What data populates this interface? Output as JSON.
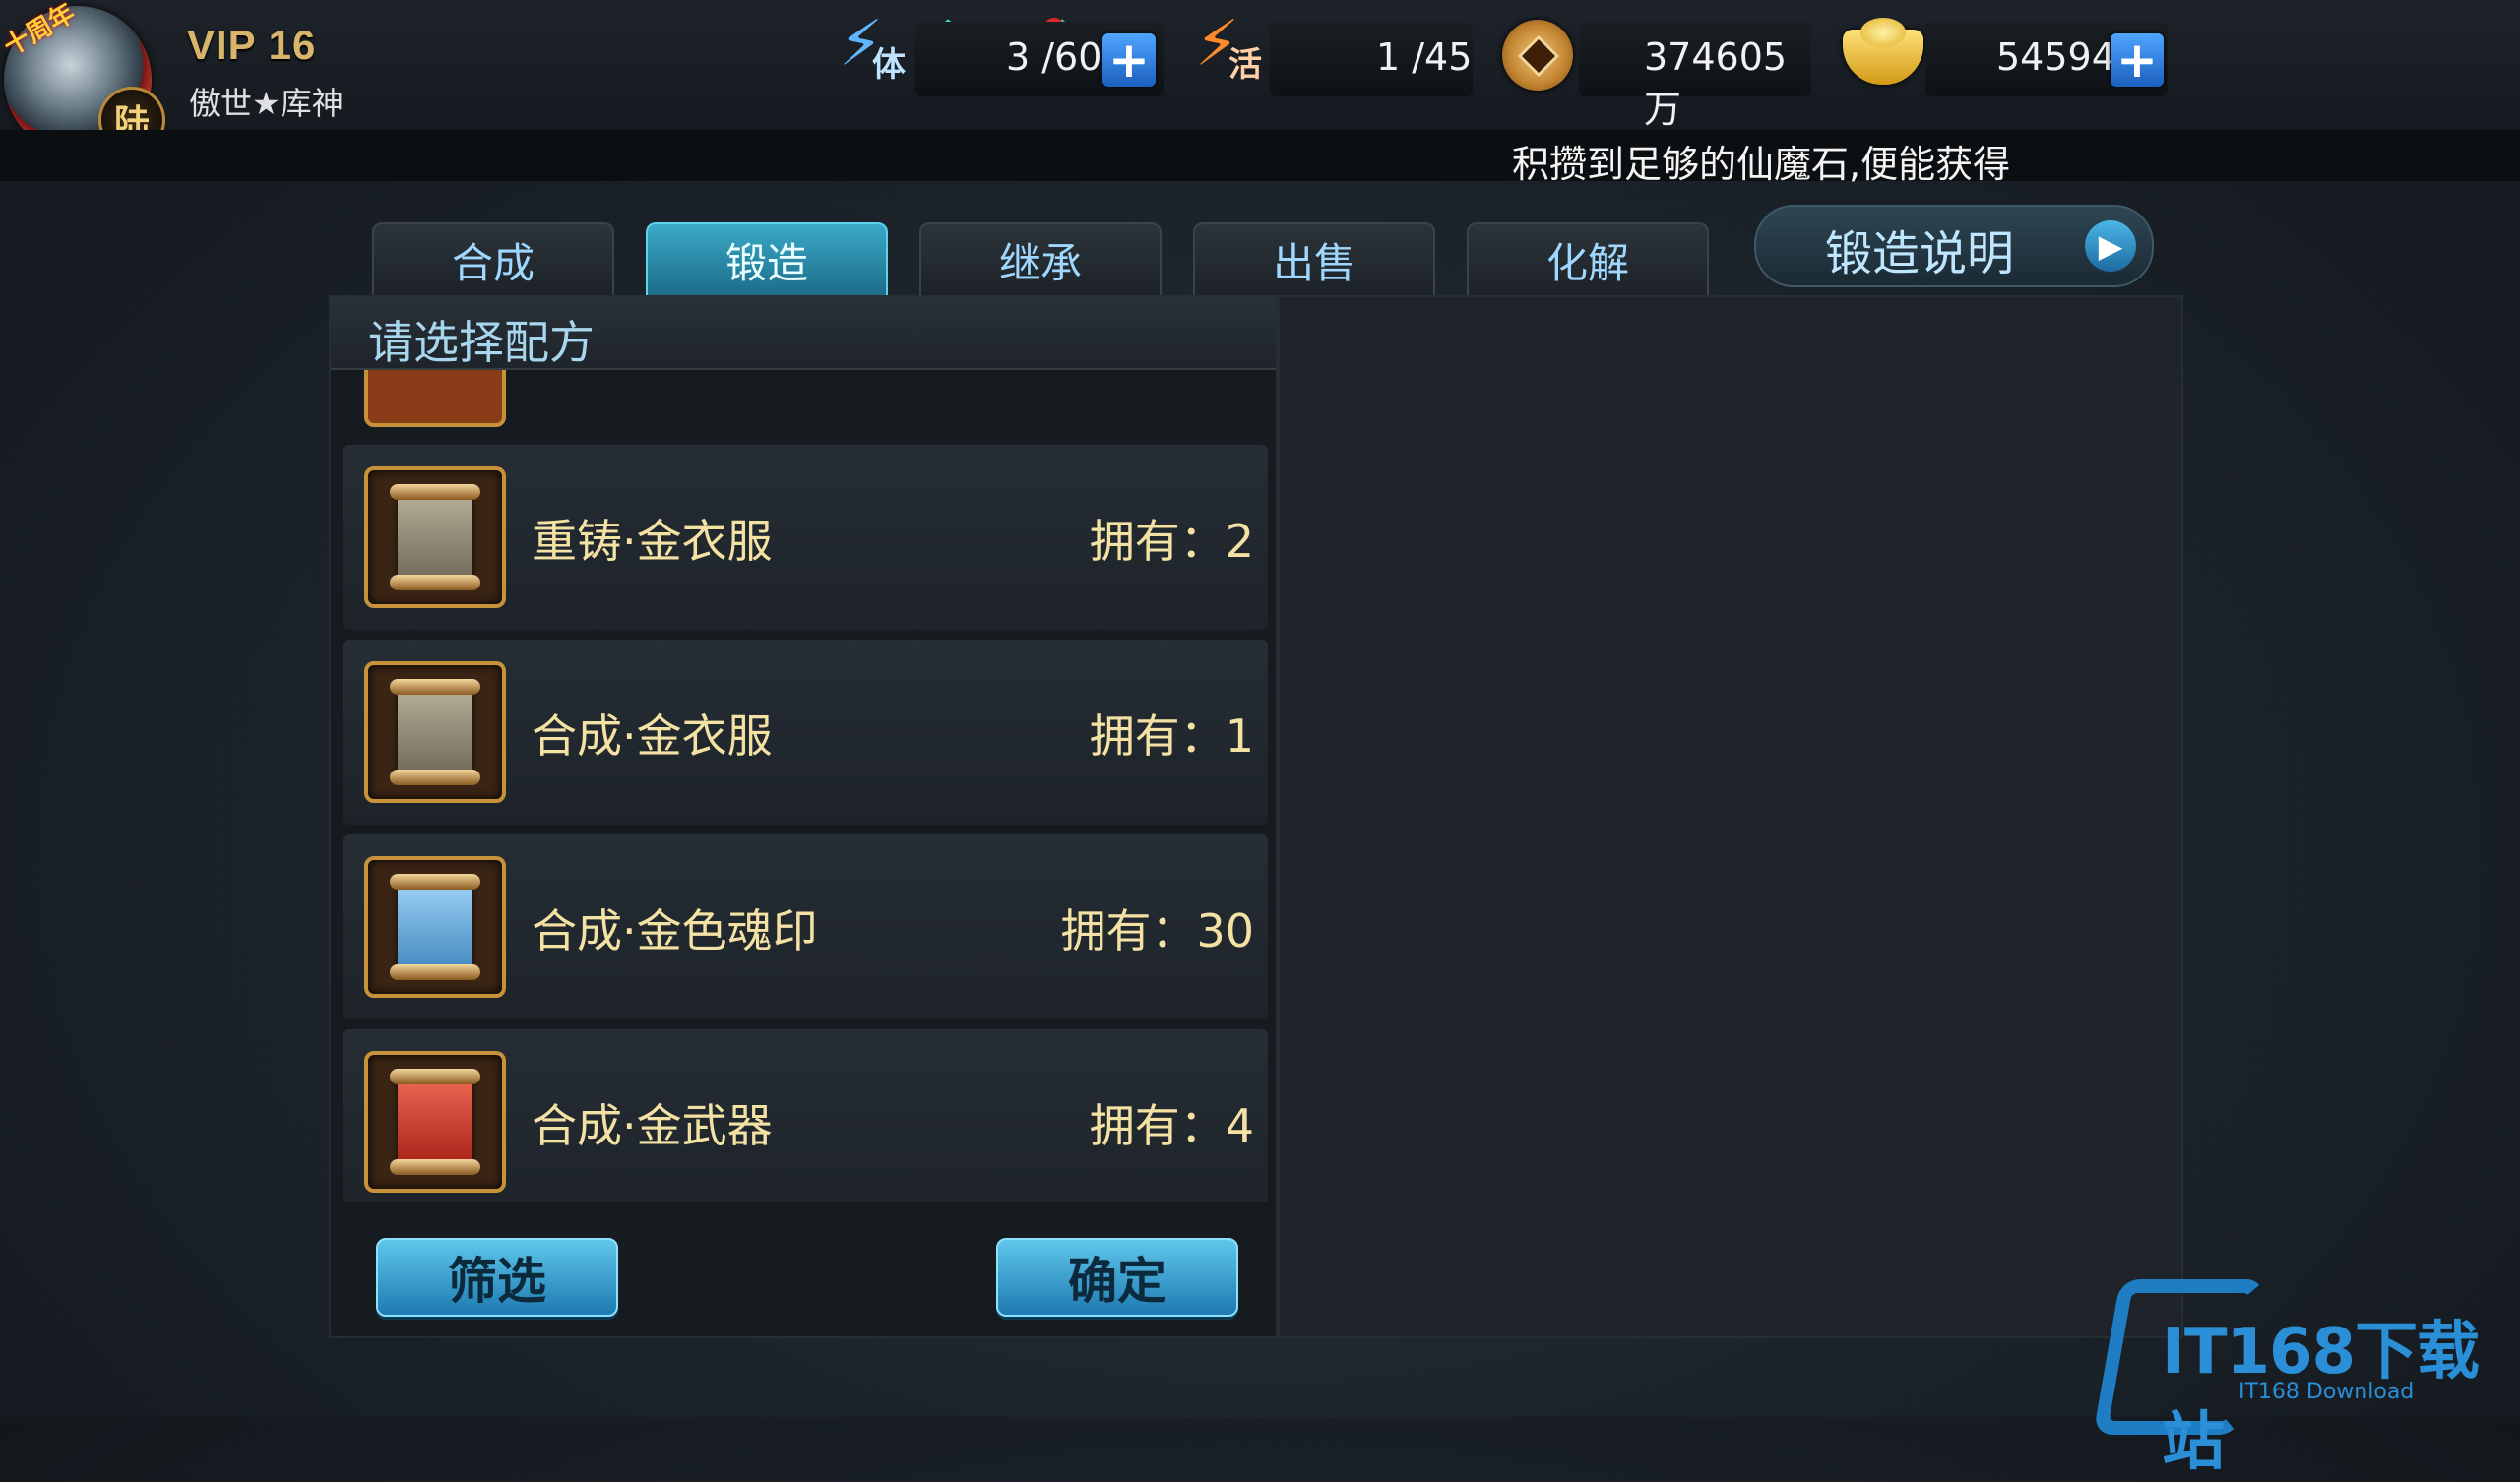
{
  "profile": {
    "ribbon": "十周年",
    "badge": "陆",
    "vip": "VIP 16",
    "name": "傲世★库神"
  },
  "stats": {
    "stamina_icon_char": "体",
    "stamina": "3 /60",
    "activity_icon_char": "活",
    "activity": "1 /45",
    "coins": "374605万",
    "ingots": "54594",
    "plus": "+"
  },
  "ticker": "积攒到足够的仙魔石,便能获得",
  "tabs": [
    {
      "label": "合成",
      "active": false
    },
    {
      "label": "锻造",
      "active": true
    },
    {
      "label": "继承",
      "active": false
    },
    {
      "label": "出售",
      "active": false
    },
    {
      "label": "化解",
      "active": false
    }
  ],
  "help_button": {
    "label": "锻造说明",
    "arrow": "▶"
  },
  "panel": {
    "title": "请选择配方",
    "recipes": [
      {
        "name": "重铸·金衣服",
        "owned": "拥有：2",
        "scroll_color": "#8f8a7a"
      },
      {
        "name": "合成·金衣服",
        "owned": "拥有：1",
        "scroll_color": "#8f8a7a"
      },
      {
        "name": "合成·金色魂印",
        "owned": "拥有：30",
        "scroll_color": "#6fb7ea"
      },
      {
        "name": "合成·金武器",
        "owned": "拥有：4",
        "scroll_color": "#d93a2b"
      }
    ],
    "filter_button": "筛选",
    "confirm_button": "确定"
  },
  "watermark": {
    "text": "IT168下载站",
    "sub": "IT168 Download"
  }
}
